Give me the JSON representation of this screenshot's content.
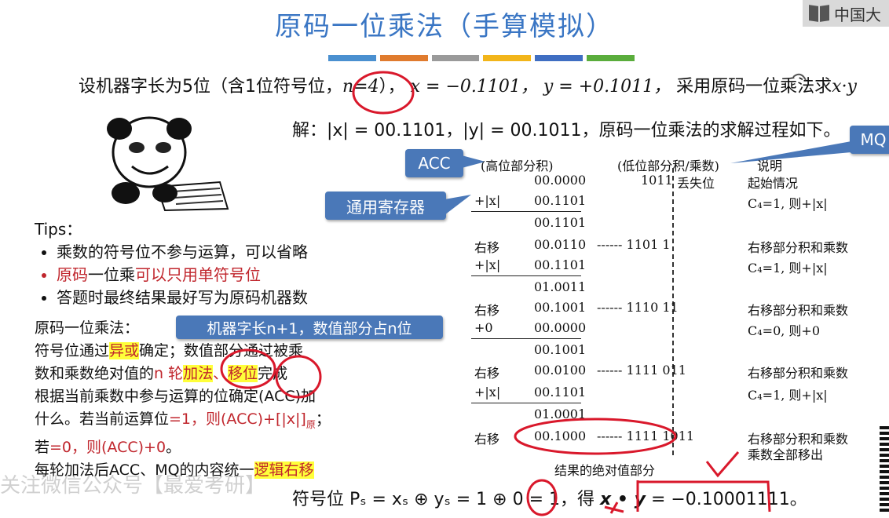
{
  "title": "原码一位乘法（手算模拟）",
  "logo_text": "中国大",
  "accent_bar_colors": [
    "#4a90d0",
    "#e07b2e",
    "#9a9a9a",
    "#f2b51a",
    "#3f6ec2",
    "#5aad3c"
  ],
  "problem": {
    "prefix": "设机器字长为5位（含1位符号位，",
    "n": "n=4",
    "suffix": "），",
    "x": "x = −0.1101，",
    "y": "y = +0.1011，",
    "tail": "采用原码一位乘法求",
    "xy": "x·y"
  },
  "solution": {
    "line": "解：|x| = 00.1101，|y| = 00.1011，原码一位乘法的求解过程如下。"
  },
  "callouts": {
    "acc": "ACC",
    "mq": "MQ",
    "register": "通用寄存器",
    "machine": "机器字长n+1，数值部分占n位"
  },
  "table": {
    "headers": {
      "high": "(高位部分积)",
      "low": "(低位部分积/乘数)",
      "note": "说明"
    },
    "rows": [
      {
        "op": "",
        "acc": "00.0000",
        "mq": "1011",
        "extra": "丢失位",
        "note": "起始情况"
      },
      {
        "op": "+|x|",
        "acc": "00.1101",
        "mq": "",
        "extra": "",
        "note": "C₄=1, 则+|x|"
      },
      {
        "op": "",
        "acc": "00.1101",
        "mq": "",
        "extra": "",
        "note": ""
      },
      {
        "op": "右移",
        "acc": "00.0110",
        "mq": "------ 1101 1",
        "extra": "",
        "note": "右移部分积和乘数"
      },
      {
        "op": "+|x|",
        "acc": "00.1101",
        "mq": "",
        "extra": "",
        "note": "C₄=1, 则+|x|"
      },
      {
        "op": "",
        "acc": "01.0011",
        "mq": "",
        "extra": "",
        "note": ""
      },
      {
        "op": "右移",
        "acc": "00.1001",
        "mq": "------ 1110 11",
        "extra": "",
        "note": "右移部分积和乘数"
      },
      {
        "op": "+0",
        "acc": "00.0000",
        "mq": "",
        "extra": "",
        "note": "C₄=0, 则+0"
      },
      {
        "op": "",
        "acc": "00.1001",
        "mq": "",
        "extra": "",
        "note": ""
      },
      {
        "op": "右移",
        "acc": "00.0100",
        "mq": "------ 1111 011",
        "extra": "",
        "note": "右移部分积和乘数"
      },
      {
        "op": "+|x|",
        "acc": "00.1101",
        "mq": "",
        "extra": "",
        "note": "C₄=1, 则+|x|"
      },
      {
        "op": "",
        "acc": "01.0001",
        "mq": "",
        "extra": "",
        "note": ""
      },
      {
        "op": "右移",
        "acc": "00.1000",
        "mq": "------ 1111 1011",
        "extra": "",
        "note": "右移部分积和乘数"
      },
      {
        "op": "",
        "acc": "",
        "mq": "",
        "extra": "",
        "note": "乘数全部移出"
      }
    ],
    "result_label": "结果的绝对值部分"
  },
  "tips": {
    "heading": "Tips：",
    "items": [
      {
        "text": "乘数的符号位不参与运算，可以省略",
        "style": "normal"
      },
      {
        "pre": "原码",
        "mid": "一位乘",
        "post": "可以只用单符号位",
        "style": "red"
      },
      {
        "text": "答题时最终结果最好写为原码机器数",
        "style": "normal"
      }
    ]
  },
  "method": {
    "label": "原码一位乘法：",
    "l2a": "符号位通过",
    "l2b": "异或",
    "l2c": "确定；数值部分通过被乘",
    "l3a": "数和乘数绝对值的",
    "l3b": "n 轮",
    "l3c": "加法",
    "l3d": "、",
    "l3e": "移位",
    "l3f": "完成",
    "l4": "根据当前乘数中参与运算的位确定(ACC)加",
    "l5a": "什么。若当前运算位",
    "l5b": "=1，则(ACC)+[|x|]",
    "l5c": "原",
    "l5d": "；",
    "l6a": "若",
    "l6b": "=0，则(ACC)+0",
    "l6c": "。",
    "l7a": "每轮加法后ACC、MQ的内容统一",
    "l7b": "逻辑右移"
  },
  "final": {
    "prefix": "符号位 Pₛ = xₛ ⊕ yₛ = 1 ⊕ 0 = 1，得",
    "xy": "x • y",
    "eq": "=",
    "result": "−0.10001111。"
  },
  "watermark": "关注微信公众号【最爱考研】"
}
